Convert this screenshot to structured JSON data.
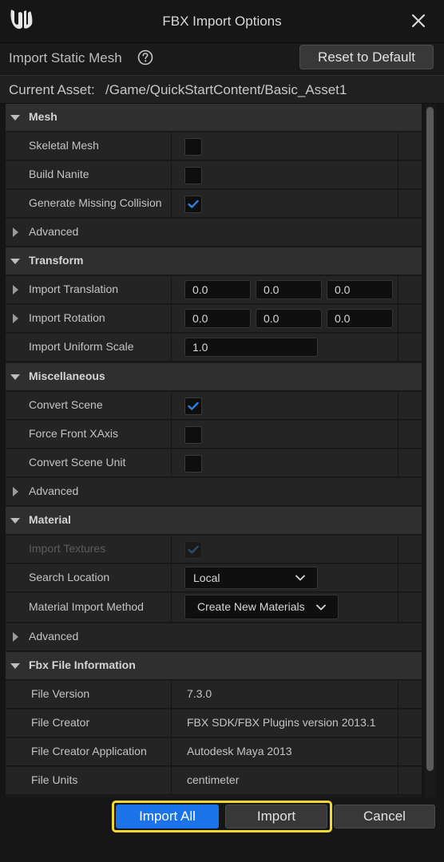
{
  "window": {
    "title": "FBX Import Options"
  },
  "header": {
    "import_label": "Import Static Mesh",
    "reset_label": "Reset to Default"
  },
  "asset": {
    "label": "Current Asset:",
    "path": "/Game/QuickStartContent/Basic_Asset1"
  },
  "mesh": {
    "title": "Mesh",
    "skeletal_mesh": {
      "label": "Skeletal Mesh",
      "checked": false
    },
    "build_nanite": {
      "label": "Build Nanite",
      "checked": false
    },
    "generate_collision": {
      "label": "Generate Missing Collision",
      "checked": true
    },
    "advanced": "Advanced"
  },
  "transform": {
    "title": "Transform",
    "translation": {
      "label": "Import Translation",
      "x": "0.0",
      "y": "0.0",
      "z": "0.0"
    },
    "rotation": {
      "label": "Import Rotation",
      "x": "0.0",
      "y": "0.0",
      "z": "0.0"
    },
    "uniform_scale": {
      "label": "Import Uniform Scale",
      "value": "1.0"
    }
  },
  "misc": {
    "title": "Miscellaneous",
    "convert_scene": {
      "label": "Convert Scene",
      "checked": true
    },
    "force_front_xaxis": {
      "label": "Force Front XAxis",
      "checked": false
    },
    "convert_scene_unit": {
      "label": "Convert Scene Unit",
      "checked": false
    },
    "advanced": "Advanced"
  },
  "material": {
    "title": "Material",
    "import_textures": {
      "label": "Import Textures",
      "checked": true,
      "enabled": false
    },
    "search_location": {
      "label": "Search Location",
      "value": "Local"
    },
    "import_method": {
      "label": "Material Import Method",
      "value": "Create New Materials"
    },
    "advanced": "Advanced"
  },
  "fbx_info": {
    "title": "Fbx File Information",
    "file_version": {
      "label": "File Version",
      "value": "7.3.0"
    },
    "file_creator": {
      "label": "File Creator",
      "value": "FBX SDK/FBX Plugins version 2013.1"
    },
    "file_creator_app": {
      "label": "File Creator Application",
      "value": "Autodesk Maya 2013"
    },
    "file_units": {
      "label": "File Units",
      "value": "centimeter"
    }
  },
  "footer": {
    "import_all": "Import All",
    "import": "Import",
    "cancel": "Cancel"
  },
  "colors": {
    "accent": "#1a73e8",
    "highlight": "#f2d833",
    "checkmark": "#2f7fe0"
  }
}
